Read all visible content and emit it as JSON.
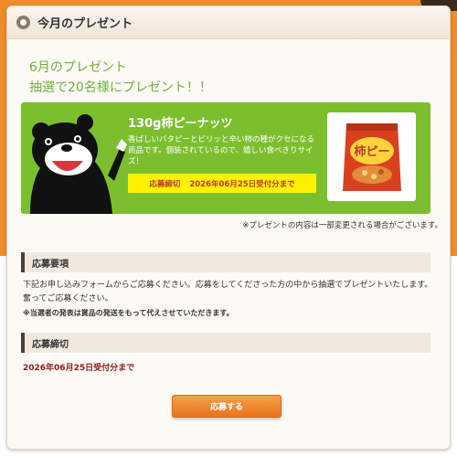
{
  "panel": {
    "title": "今月のプレゼント"
  },
  "intro": {
    "line1": "6月のプレゼント",
    "line2": "抽選で20名様にプレゼント！！"
  },
  "product": {
    "name": "130g柿ピーナッツ",
    "description": "香ばしいバタピーとピリッと辛い柿の種がクセになる商品です。個装されているので、嬉しい食べきりサイズ！",
    "deadline_label": "応募締切",
    "deadline_value": "2026年06月25日受付分まで",
    "package_text": "柿ピー"
  },
  "note": "※プレゼントの内容は一部変更される場合がございます。",
  "requirements": {
    "heading": "応募要項",
    "text": "下記お申し込みフォームからご応募ください。応募をしてくださった方の中から抽選でプレゼントいたします。奮ってご応募ください。",
    "note": "※当選者の発表は賞品の発送をもって代えさせていただきます。"
  },
  "deadline_section": {
    "heading": "応募締切",
    "text": "2026年06月25日受付分まで"
  },
  "apply_button": {
    "label": "応募する"
  },
  "colors": {
    "background_orange": "#f08b2a",
    "banner_green": "#7cbf2e",
    "intro_green": "#6db33f",
    "deadline_yellow": "#fff200",
    "deadline_red": "#c0392b",
    "button_orange": "#e8741c"
  },
  "icons": {
    "header": "circle-bullet-icon",
    "mascot": "bear-mascot-icon",
    "product": "snack-package-icon"
  }
}
